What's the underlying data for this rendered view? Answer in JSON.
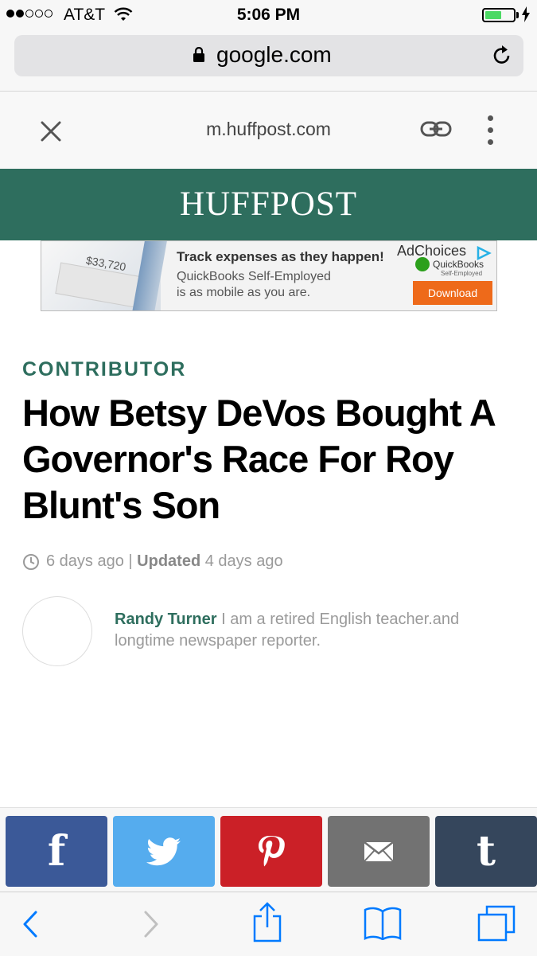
{
  "status_bar": {
    "carrier": "AT&T",
    "time": "5:06 PM",
    "signal_bars_filled": 2,
    "signal_bars_total": 5,
    "battery_level": 0.6,
    "battery_color": "#4cd964"
  },
  "browser": {
    "url": "google.com",
    "icons": [
      "lock-icon",
      "reload-icon"
    ]
  },
  "amp_viewer": {
    "domain": "m.huffpost.com",
    "icons": [
      "close-icon",
      "link-icon",
      "more-icon"
    ]
  },
  "site": {
    "logo": "HUFFPOST",
    "brand_color": "#2e6e5e"
  },
  "ad": {
    "amount": "$33,720",
    "headline": "Track expenses as they happen!",
    "subline_1": "QuickBooks Self-Employed",
    "subline_2": "is as mobile as you are.",
    "adchoices": "AdChoices",
    "brand": "QuickBooks",
    "brand_sub": "Self-Employed",
    "cta": "Download"
  },
  "article": {
    "kicker": "CONTRIBUTOR",
    "headline": "How Betsy DeVos Bought A Governor's Race For Roy Blunt's Son",
    "published": "6 days ago",
    "separator": " | ",
    "updated_label": "Updated",
    "updated": "4 days ago",
    "author_name": "Randy Turner",
    "author_bio": " I am a retired English teacher.and longtime newspaper reporter."
  },
  "share": {
    "buttons": [
      {
        "name": "facebook",
        "color": "#3b5998",
        "glyph": "f"
      },
      {
        "name": "twitter",
        "color": "#55acee"
      },
      {
        "name": "pinterest",
        "color": "#cb2027"
      },
      {
        "name": "email",
        "color": "#727272"
      },
      {
        "name": "tumblr",
        "color": "#35465c",
        "glyph": "t"
      }
    ]
  },
  "toolbar": {
    "icons": [
      "back-icon",
      "forward-icon",
      "share-icon",
      "bookmarks-icon",
      "tabs-icon"
    ],
    "accent": "#007aff"
  }
}
